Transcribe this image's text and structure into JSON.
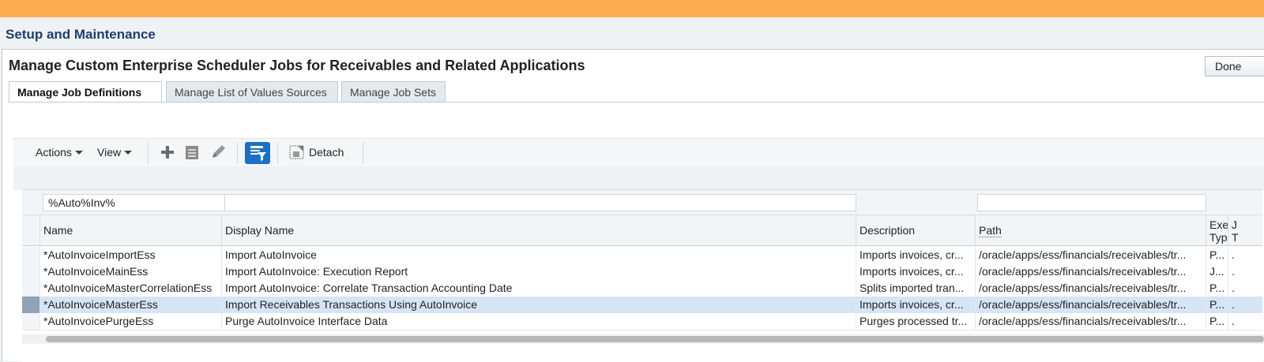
{
  "app_title": "Setup and Maintenance",
  "page_title": "Manage Custom Enterprise Scheduler Jobs for Receivables and Related Applications",
  "done_label": "Done",
  "tabs": [
    {
      "label": "Manage Job Definitions",
      "active": true
    },
    {
      "label": "Manage List of Values Sources",
      "active": false
    },
    {
      "label": "Manage Job Sets",
      "active": false
    }
  ],
  "toolbar": {
    "actions_label": "Actions",
    "view_label": "View",
    "detach_label": "Detach",
    "icons": [
      "add-icon",
      "duplicate-icon",
      "edit-icon",
      "query-by-example-icon",
      "detach-icon"
    ]
  },
  "filters": {
    "name": "%Auto%Inv%",
    "display_name": "",
    "path": ""
  },
  "columns": {
    "name": "Name",
    "display_name": "Display Name",
    "description": "Description",
    "path": "Path",
    "exec_type_line1": "Exec",
    "exec_type_line2": "Type",
    "job_type_line1": "J",
    "job_type_line2": "T"
  },
  "rows": [
    {
      "name": "*AutoInvoiceImportEss",
      "display_name": "Import AutoInvoice",
      "description": "Imports invoices, cr...",
      "path": "/oracle/apps/ess/financials/receivables/tr...",
      "exec": "P...",
      "job": "."
    },
    {
      "name": "*AutoInvoiceMainEss",
      "display_name": "Import AutoInvoice: Execution Report",
      "description": "Imports invoices, cr...",
      "path": "/oracle/apps/ess/financials/receivables/tr...",
      "exec": "J...",
      "job": "."
    },
    {
      "name": "*AutoInvoiceMasterCorrelationEss",
      "display_name": "Import AutoInvoice: Correlate Transaction Accounting Date",
      "description": "Splits imported tran...",
      "path": "/oracle/apps/ess/financials/receivables/tr...",
      "exec": "P...",
      "job": "."
    },
    {
      "name": "*AutoInvoiceMasterEss",
      "display_name": "Import Receivables Transactions Using AutoInvoice",
      "description": "Imports invoices, cr...",
      "path": "/oracle/apps/ess/financials/receivables/tr...",
      "exec": "P...",
      "job": ".",
      "selected": true
    },
    {
      "name": "*AutoInvoicePurgeEss",
      "display_name": "Purge AutoInvoice Interface Data",
      "description": "Purges processed tr...",
      "path": "/oracle/apps/ess/financials/receivables/tr...",
      "exec": "P...",
      "job": "."
    }
  ],
  "colors": {
    "top_bar": "#fdad52",
    "app_title": "#1f3e6b",
    "selected_row": "#d6e5f5",
    "filter_button": "#1b6fc4"
  }
}
